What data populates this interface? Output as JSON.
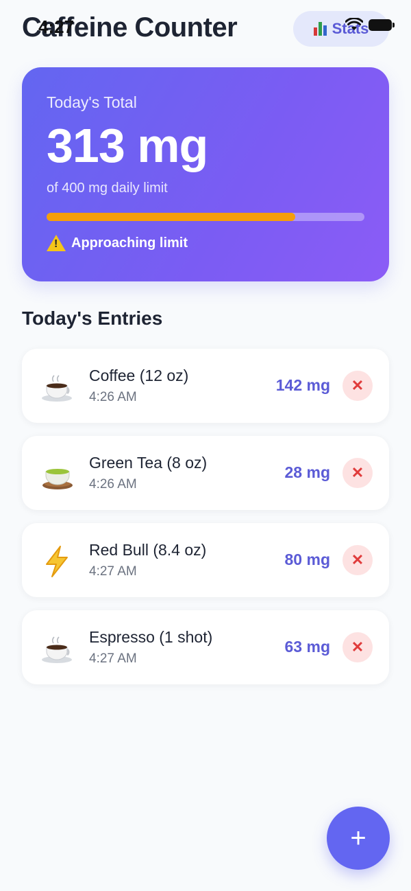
{
  "status_bar": {
    "time": "4:27"
  },
  "header": {
    "title": "Caffeine Counter",
    "stats_label": "Stats",
    "stats_icon": "bar-chart-icon"
  },
  "summary": {
    "label": "Today's Total",
    "total": "313 mg",
    "limit_text": "of 400 mg daily limit",
    "progress_percent": 78.25,
    "warning": "Approaching limit",
    "warning_icon": "warning-icon",
    "progress_color": "#f59e0b",
    "card_color": "#6366f1"
  },
  "entries": {
    "title": "Today's Entries",
    "items": [
      {
        "name": "Coffee (12 oz)",
        "time": "4:26 AM",
        "amount": "142 mg",
        "icon": "coffee-cup-icon",
        "delete_label": "✕"
      },
      {
        "name": "Green Tea (8 oz)",
        "time": "4:26 AM",
        "amount": "28 mg",
        "icon": "tea-cup-icon",
        "delete_label": "✕"
      },
      {
        "name": "Red Bull (8.4 oz)",
        "time": "4:27 AM",
        "amount": "80 mg",
        "icon": "lightning-icon",
        "delete_label": "✕"
      },
      {
        "name": "Espresso (1 shot)",
        "time": "4:27 AM",
        "amount": "63 mg",
        "icon": "coffee-cup-icon",
        "delete_label": "✕"
      }
    ]
  },
  "fab": {
    "label": "+"
  },
  "colors": {
    "accent": "#6366f1",
    "delete_bg": "#fde2e2",
    "delete_fg": "#e03b3b"
  }
}
